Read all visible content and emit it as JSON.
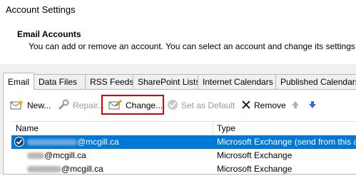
{
  "window": {
    "title": "Account Settings"
  },
  "header": {
    "title": "Email Accounts",
    "description": "You can add or remove an account. You can select an account and change its settings."
  },
  "tabs": [
    {
      "label": "Email",
      "active": true
    },
    {
      "label": "Data Files"
    },
    {
      "label": "RSS Feeds"
    },
    {
      "label": "SharePoint Lists"
    },
    {
      "label": "Internet Calendars"
    },
    {
      "label": "Published Calendars"
    }
  ],
  "toolbar": {
    "new_label": "New...",
    "repair_label": "Repair...",
    "change_label": "Change...",
    "set_default_label": "Set as Default",
    "remove_label": "Remove"
  },
  "grid": {
    "columns": [
      "Name",
      "Type"
    ],
    "rows": [
      {
        "name": "@mcgill.ca",
        "type": "Microsoft Exchange (send from this acc",
        "selected": true,
        "default": true
      },
      {
        "name": "@mcgill.ca",
        "type": "Microsoft Exchange"
      },
      {
        "name": "@mcgill.ca",
        "type": "Microsoft Exchange"
      }
    ]
  },
  "colors": {
    "selection": "#0078d7",
    "highlight": "#e00000"
  }
}
